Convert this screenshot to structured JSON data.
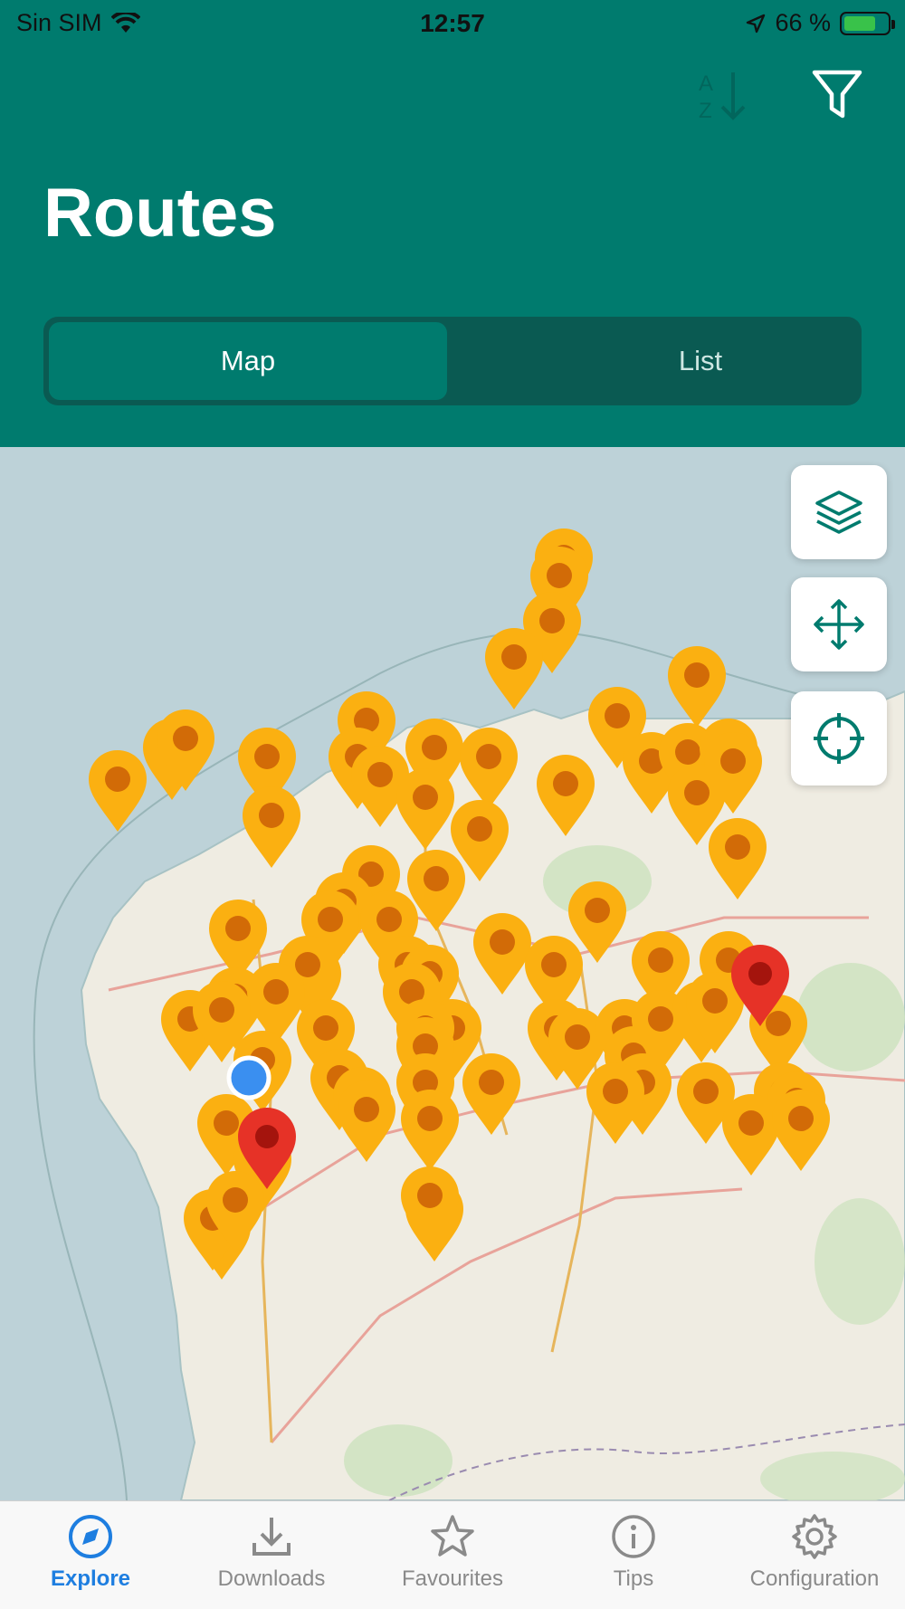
{
  "status_bar": {
    "carrier": "Sin SIM",
    "time": "12:57",
    "battery": "66 %"
  },
  "header": {
    "title": "Routes",
    "sort_icon": "sort-az-icon",
    "filter_icon": "filter-icon"
  },
  "segment": {
    "options": [
      "Map",
      "List"
    ],
    "selected": "Map"
  },
  "map": {
    "controls": [
      {
        "name": "layers",
        "icon": "layers-icon"
      },
      {
        "name": "move",
        "icon": "move-icon"
      },
      {
        "name": "locate",
        "icon": "crosshair-icon"
      }
    ],
    "pin_color": "#fbb011",
    "pin_dot_color": "#d26b07",
    "highlight_pin_color": "#e63227",
    "user_location_color": "#3a8ff0",
    "land_color": "#f2efe9",
    "water_color": "#bdd2d8"
  },
  "tabbar": {
    "items": [
      {
        "label": "Explore",
        "icon": "compass-icon",
        "active": true
      },
      {
        "label": "Downloads",
        "icon": "download-icon",
        "active": false
      },
      {
        "label": "Favourites",
        "icon": "star-icon",
        "active": false
      },
      {
        "label": "Tips",
        "icon": "info-icon",
        "active": false
      },
      {
        "label": "Configuration",
        "icon": "gear-icon",
        "active": false
      }
    ]
  },
  "colors": {
    "header_bg": "#007b6e",
    "segment_bg": "#0a5a52",
    "active_tab": "#1e7ee0",
    "inactive_tab": "#8a8a8a"
  }
}
